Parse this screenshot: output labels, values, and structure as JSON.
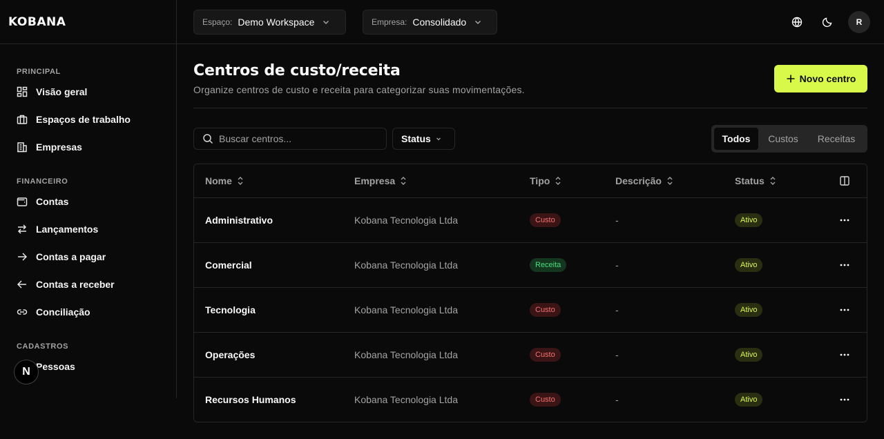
{
  "app": {
    "logo": "KOBANA"
  },
  "header": {
    "workspace_key": "Espaço:",
    "workspace_value": "Demo Workspace",
    "company_key": "Empresa:",
    "company_value": "Consolidado",
    "avatar_initial": "R"
  },
  "sidebar": {
    "sections": [
      {
        "label": "PRINCIPAL",
        "items": [
          {
            "label": "Visão geral",
            "icon": "dashboard-icon"
          },
          {
            "label": "Espaços de trabalho",
            "icon": "briefcase-icon"
          },
          {
            "label": "Empresas",
            "icon": "building-icon"
          }
        ]
      },
      {
        "label": "FINANCEIRO",
        "items": [
          {
            "label": "Contas",
            "icon": "wallet-icon"
          },
          {
            "label": "Lançamentos",
            "icon": "swap-icon"
          },
          {
            "label": "Contas a pagar",
            "icon": "arrow-right-icon"
          },
          {
            "label": "Contas a receber",
            "icon": "arrow-left-icon"
          },
          {
            "label": "Conciliação",
            "icon": "link-icon"
          }
        ]
      },
      {
        "label": "CADASTROS",
        "items": [
          {
            "label": "Pessoas",
            "icon": "users-icon"
          }
        ]
      }
    ]
  },
  "page": {
    "title": "Centros de custo/receita",
    "subtitle": "Organize centros de custo e receita para categorizar suas movimentações.",
    "new_button": "Novo centro"
  },
  "filters": {
    "search_placeholder": "Buscar centros...",
    "status_label": "Status",
    "segments": [
      "Todos",
      "Custos",
      "Receitas"
    ],
    "active_segment": "Todos"
  },
  "table": {
    "columns": [
      "Nome",
      "Empresa",
      "Tipo",
      "Descrição",
      "Status"
    ],
    "rows": [
      {
        "nome": "Administrativo",
        "empresa": "Kobana Tecnologia Ltda",
        "tipo": "Custo",
        "descricao": "-",
        "status": "Ativo"
      },
      {
        "nome": "Comercial",
        "empresa": "Kobana Tecnologia Ltda",
        "tipo": "Receita",
        "descricao": "-",
        "status": "Ativo"
      },
      {
        "nome": "Tecnologia",
        "empresa": "Kobana Tecnologia Ltda",
        "tipo": "Custo",
        "descricao": "-",
        "status": "Ativo"
      },
      {
        "nome": "Operações",
        "empresa": "Kobana Tecnologia Ltda",
        "tipo": "Custo",
        "descricao": "-",
        "status": "Ativo"
      },
      {
        "nome": "Recursos Humanos",
        "empresa": "Kobana Tecnologia Ltda",
        "tipo": "Custo",
        "descricao": "-",
        "status": "Ativo"
      }
    ]
  },
  "floating_badge": "N",
  "colors": {
    "accent": "#d9f94a",
    "background": "#0a0a0a",
    "border": "#262626"
  }
}
